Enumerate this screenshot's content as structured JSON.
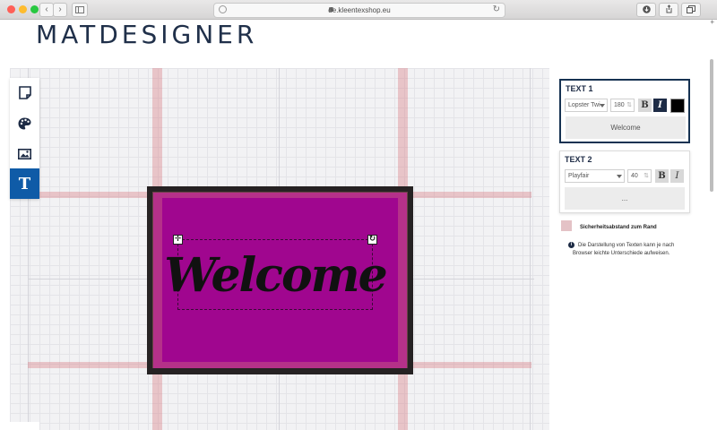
{
  "browser": {
    "url": "de.kleentexshop.eu",
    "back_glyph": "‹",
    "forward_glyph": "›",
    "reload_glyph": "↻",
    "new_tab_glyph": "+"
  },
  "header": {
    "logo": "MATDESIGNER"
  },
  "toolbar": {
    "items": [
      {
        "icon": "mat-shape-icon"
      },
      {
        "icon": "palette-icon"
      },
      {
        "icon": "image-icon"
      },
      {
        "icon": "text-icon",
        "label": "T",
        "active": true
      }
    ]
  },
  "mat": {
    "text": "Welcome",
    "color": "#a0068f",
    "border_color": "#262223",
    "move_handle": "✛",
    "rotate_handle": "↻"
  },
  "panel": {
    "text1": {
      "title": "TEXT 1",
      "font": "Lopster Twi",
      "size": "180",
      "bold_label": "B",
      "italic_label": "I",
      "color": "#000000",
      "value": "Welcome"
    },
    "text2": {
      "title": "TEXT 2",
      "font": "Playfair",
      "size": "40",
      "bold_label": "B",
      "italic_label": "I",
      "value": "..."
    },
    "legend": "Sicherheitsabstand zum Rand",
    "info_icon": "i",
    "info": "Die Darstellung von Texten kann je nach Browser leichte Unterschiede aufweisen."
  },
  "colors": {
    "accent": "#0f5ba7",
    "navy": "#1d2b45",
    "guide": "#e4c2c6"
  }
}
